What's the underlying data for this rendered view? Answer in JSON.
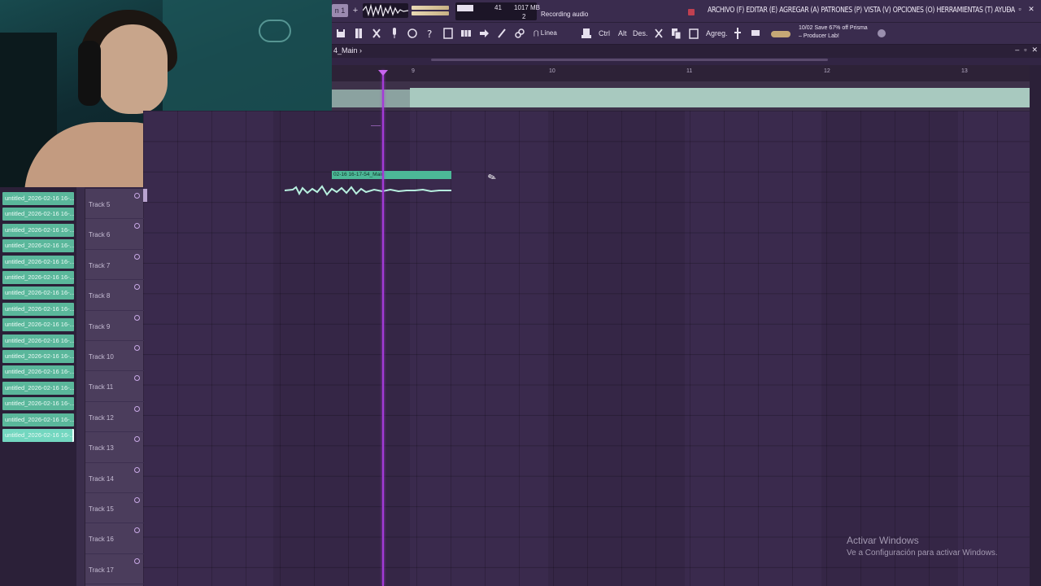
{
  "menubar": {
    "pattern": "n 1",
    "plus": "+",
    "cpu_value": "41",
    "memory": "1017 MB",
    "polyphony": "2",
    "hint": "Recording audio",
    "menu": [
      "ARCHIVO (F)",
      "EDITAR (E)",
      "AGREGAR (A)",
      "PATRONES (P)",
      "VISTA (V)",
      "OPCIONES (O)",
      "HERRAMIENTAS (T)",
      "AYUDA"
    ],
    "window_controls": [
      "–",
      "▫",
      "✕"
    ]
  },
  "toolbar": {
    "snap_label": "Línea",
    "ctrl_label": "Ctrl",
    "alt_label": "Alt",
    "des_label": "Des.",
    "agreg_label": "Agreg.",
    "promo_line1": "10/02  Save 67% off Prisma",
    "promo_line2": "– Producer Lab!"
  },
  "playlist": {
    "title": "4_Main",
    "title_arrow": "›",
    "controls": [
      "–",
      "▫",
      "✕"
    ],
    "ruler_ticks": [
      "9",
      "10",
      "11",
      "12",
      "13"
    ]
  },
  "recorded_clip": {
    "label": "02-16 16-17-54_Main"
  },
  "tracks": [
    "Track 5",
    "Track 6",
    "Track 7",
    "Track 8",
    "Track 9",
    "Track 10",
    "Track 11",
    "Track 12",
    "Track 13",
    "Track 14",
    "Track 15",
    "Track 16",
    "Track 17"
  ],
  "browser": {
    "items": [
      "untitled_2026-02-16 16-...",
      "untitled_2026-02-16 16-...",
      "untitled_2026-02-16 16-...",
      "untitled_2026-02-16 16-...",
      "untitled_2026-02-16 16-...",
      "untitled_2026-02-16 16-...",
      "untitled_2026-02-16 16-...",
      "untitled_2026-02-16 16-...",
      "untitled_2026-02-16 16-...",
      "untitled_2026-02-16 16-...",
      "untitled_2026-02-16 16-...",
      "untitled_2026-02-16 16-...",
      "untitled_2026-02-16 16-...",
      "untitled_2026-02-16 16-...",
      "untitled_2026-02-16 16-...",
      "untitled_2026-02-16 16-..."
    ],
    "selected_index": 15
  },
  "watermark": {
    "title": "Activar Windows",
    "subtitle": "Ve a Configuración para activar Windows."
  },
  "colors": {
    "background": "#322544",
    "clip": "#4cb897",
    "playhead": "#a43ad8",
    "browser_item": "#5ab79b"
  }
}
